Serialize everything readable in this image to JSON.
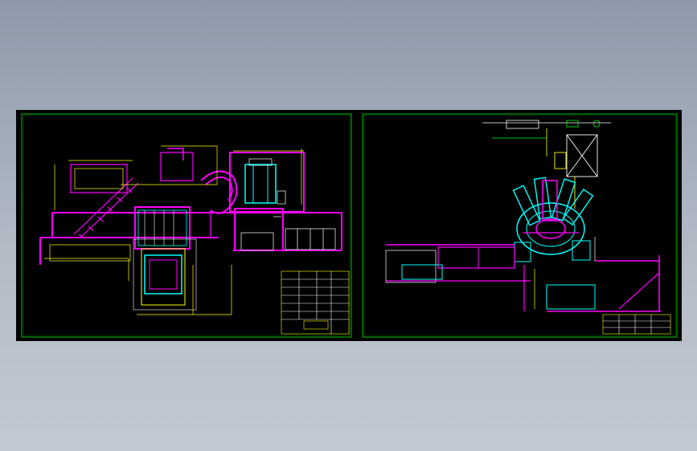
{
  "colors": {
    "background_top": "#8d98a8",
    "background_bottom": "#c3c9d2",
    "model_space": "#000000",
    "frame": "#00c000",
    "magenta": "#ff00ff",
    "yellow": "#ffff00",
    "cyan": "#00ffff",
    "white": "#ffffff",
    "green": "#00ff00"
  },
  "sheets": [
    {
      "name": "left-sheet",
      "drawing": "plant-section-elevation",
      "title_block": "present",
      "frame_color": "green"
    },
    {
      "name": "right-sheet",
      "drawing": "radial-equipment-elevation",
      "title_block": "present",
      "frame_color": "green"
    }
  ],
  "icons": [
    "cad-drawing-canvas"
  ]
}
